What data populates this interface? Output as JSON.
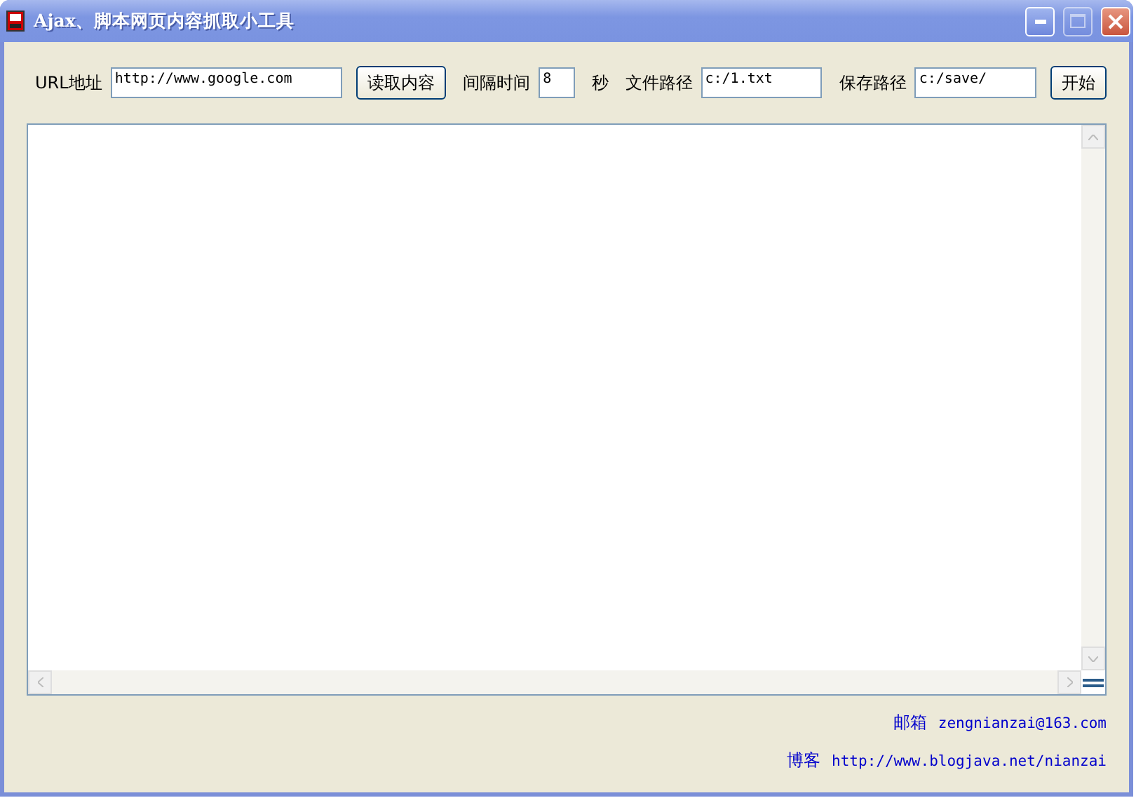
{
  "window": {
    "title": "Ajax、脚本网页内容抓取小工具",
    "maximize_disabled": true
  },
  "toolbar": [
    {
      "kind": "label",
      "text": "URL地址"
    },
    {
      "kind": "field",
      "value": "http://www.google.com"
    },
    {
      "kind": "button",
      "text": "读取内容"
    },
    {
      "kind": "label",
      "text": "间隔时间"
    },
    {
      "kind": "field",
      "value": "8"
    },
    {
      "kind": "label",
      "text": "秒"
    },
    {
      "kind": "label",
      "text": "文件路径"
    },
    {
      "kind": "field",
      "value": "c:/1.txt"
    },
    {
      "kind": "label",
      "text": "保存路径"
    },
    {
      "kind": "field",
      "value": "c:/save/"
    },
    {
      "kind": "button",
      "text": "开始"
    }
  ],
  "footer": [
    {
      "label": "邮箱",
      "value": "zengnianzai@163.com"
    },
    {
      "label": "博客",
      "value": "http://www.blogjava.net/nianzai"
    }
  ]
}
